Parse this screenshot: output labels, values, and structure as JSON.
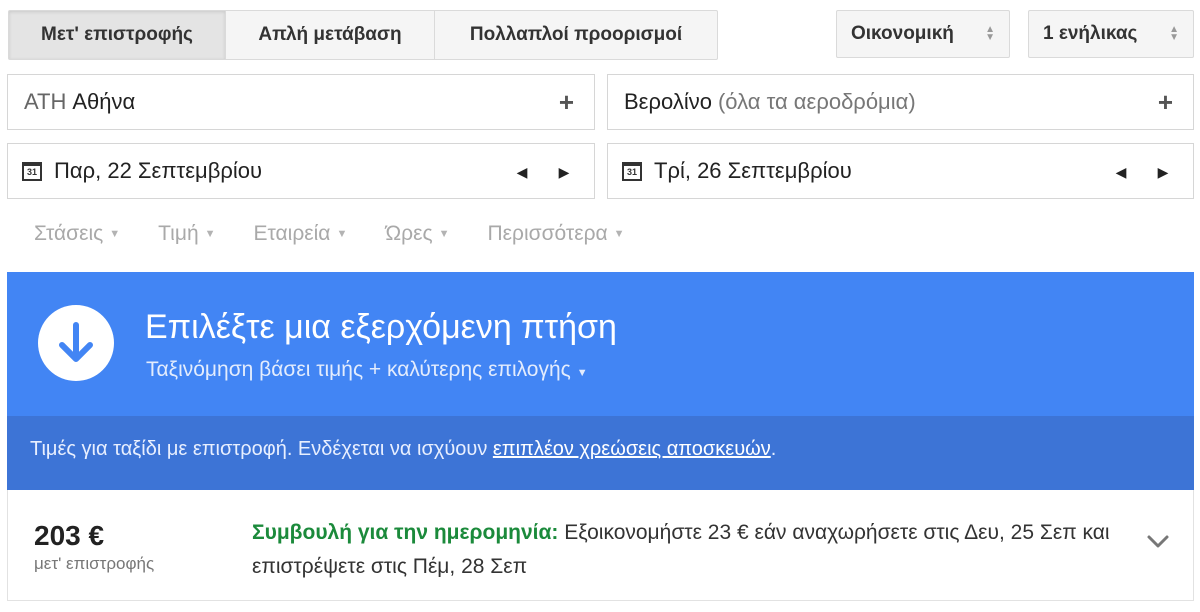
{
  "trip_tabs": [
    {
      "label": "Μετ' επιστροφής",
      "active": true
    },
    {
      "label": "Απλή μετάβαση",
      "active": false
    },
    {
      "label": "Πολλαπλοί προορισμοί",
      "active": false
    }
  ],
  "cabin_class": {
    "value": "Οικονομική"
  },
  "passengers": {
    "value": "1 ενήλικας"
  },
  "origin": {
    "code": "ΑΤΗ",
    "city": "Αθήνα",
    "add": "+"
  },
  "destination": {
    "city": "Βερολίνο",
    "hint": "(όλα τα αεροδρόμια)",
    "add": "+"
  },
  "departure": {
    "calendar_day": "31",
    "date": "Παρ, 22 Σεπτεμβρίου"
  },
  "return": {
    "calendar_day": "31",
    "date": "Τρί, 26 Σεπτεμβρίου"
  },
  "filters": [
    "Στάσεις",
    "Τιμή",
    "Εταιρεία",
    "Ώρες",
    "Περισσότερα"
  ],
  "banner": {
    "title": "Επιλέξτε μια εξερχόμενη πτήση",
    "sort": "Ταξινόμηση βάσει τιμής + καλύτερης επιλογής"
  },
  "notice": {
    "text": "Τιμές για ταξίδι με επιστροφή. Ενδέχεται να ισχύουν ",
    "link": "επιπλέον χρεώσεις αποσκευών",
    "end": "."
  },
  "result": {
    "price": "203 €",
    "price_sub": "μετ' επιστροφής",
    "tip_label": "Συμβουλή για την ημερομηνία:",
    "tip_text": " Εξοικονομήστε 23 € εάν αναχωρήσετε στις Δευ, 25 Σεπ και επιστρέψετε στις Πέμ, 28 Σεπ"
  },
  "colors": {
    "banner": "#4285f4",
    "notice": "#3d74d6",
    "tip_green": "#1b8a3b"
  }
}
